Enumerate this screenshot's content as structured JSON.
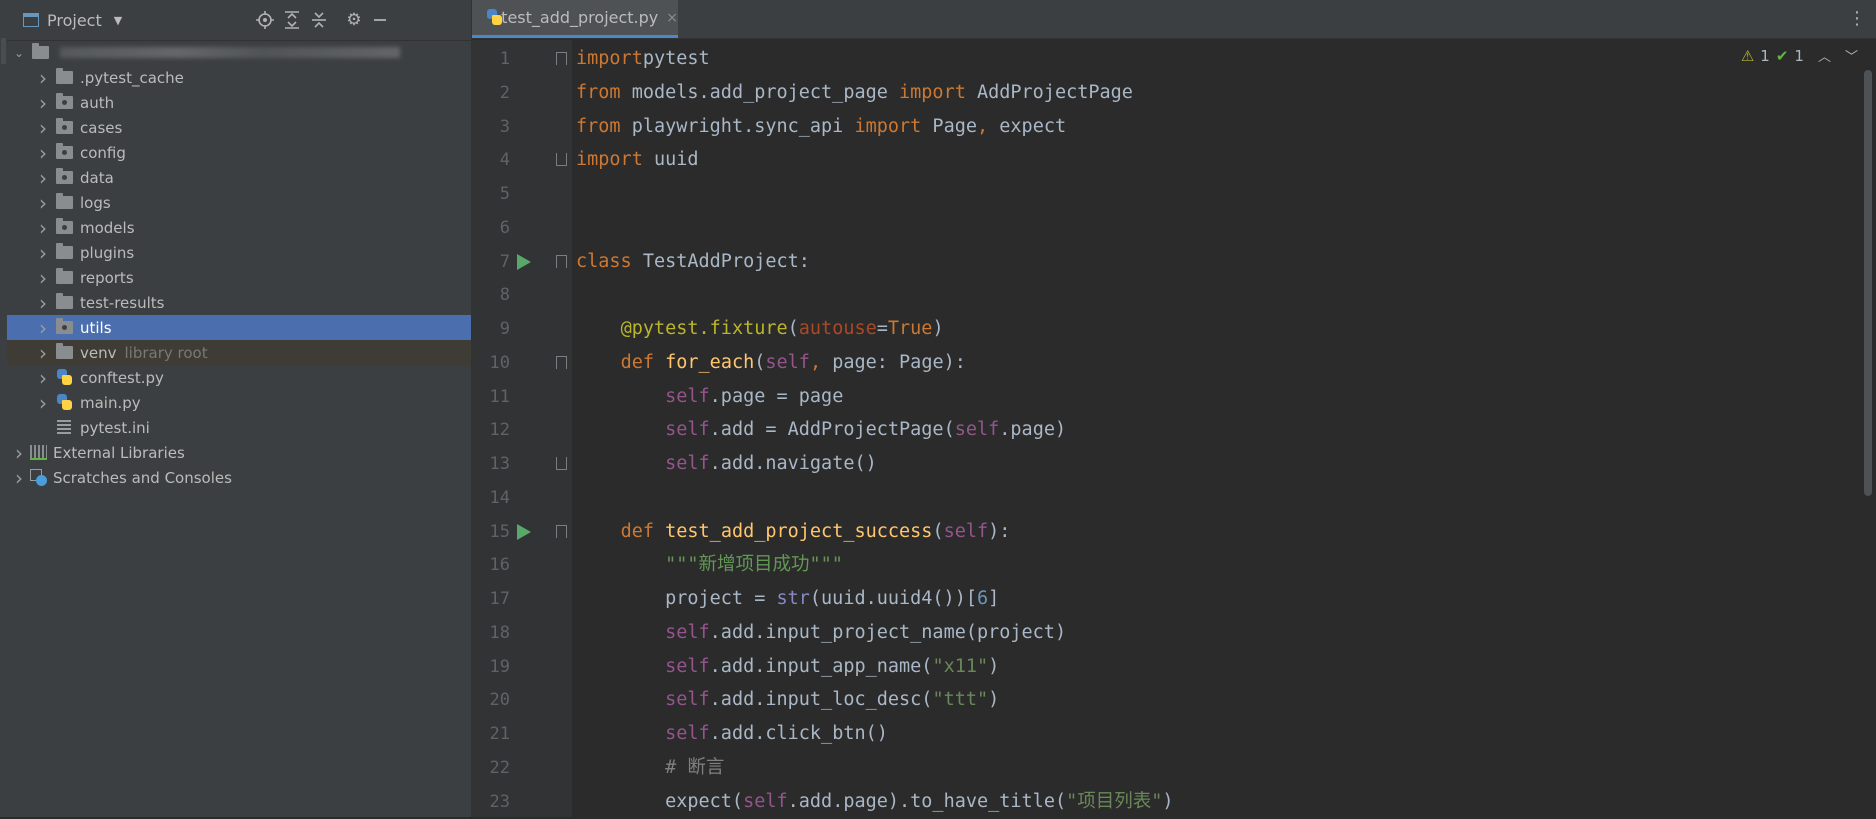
{
  "project_panel": {
    "title": "Project",
    "header_icons": [
      "locate-icon",
      "expand-all-icon",
      "collapse-all-icon",
      "gear-icon",
      "minimize-icon"
    ],
    "tree": [
      {
        "label": ".pytest_cache",
        "kind": "folder"
      },
      {
        "label": "auth",
        "kind": "package"
      },
      {
        "label": "cases",
        "kind": "package"
      },
      {
        "label": "config",
        "kind": "package"
      },
      {
        "label": "data",
        "kind": "package"
      },
      {
        "label": "logs",
        "kind": "folder"
      },
      {
        "label": "models",
        "kind": "package"
      },
      {
        "label": "plugins",
        "kind": "folder"
      },
      {
        "label": "reports",
        "kind": "folder"
      },
      {
        "label": "test-results",
        "kind": "folder"
      },
      {
        "label": "utils",
        "kind": "package",
        "selected": true
      },
      {
        "label": "venv",
        "kind": "folder",
        "hint": "library root"
      },
      {
        "label": "conftest.py",
        "kind": "python"
      },
      {
        "label": "main.py",
        "kind": "python"
      },
      {
        "label": "pytest.ini",
        "kind": "ini"
      },
      {
        "label": "External Libraries",
        "kind": "libraries"
      },
      {
        "label": "Scratches and Consoles",
        "kind": "scratches"
      }
    ]
  },
  "editor": {
    "tab": {
      "label": "test_add_project.py",
      "close": "×"
    },
    "menu": "⋮",
    "status": {
      "warnings": "1",
      "checks": "1"
    },
    "line_numbers": [
      "1",
      "2",
      "3",
      "4",
      "5",
      "6",
      "7",
      "8",
      "9",
      "10",
      "11",
      "12",
      "13",
      "14",
      "15",
      "16",
      "17",
      "18",
      "19",
      "20",
      "21",
      "22",
      "23"
    ],
    "lines": [
      [
        [
          "kw",
          "import"
        ],
        [
          "",
          "pytest"
        ]
      ],
      [
        [
          "kw",
          "from"
        ],
        [
          "",
          " models.add_project_page "
        ],
        [
          "kw",
          "import"
        ],
        [
          "",
          " AddProjectPage"
        ]
      ],
      [
        [
          "kw",
          "from"
        ],
        [
          "",
          " playwright.sync_api "
        ],
        [
          "kw",
          "import"
        ],
        [
          "",
          " Page"
        ],
        [
          "kw",
          ","
        ],
        [
          "",
          " expect"
        ]
      ],
      [
        [
          "kw",
          "import"
        ],
        [
          "",
          " uuid"
        ]
      ],
      [],
      [],
      [
        [
          "kw",
          "class"
        ],
        [
          "",
          " TestAddProject:"
        ]
      ],
      [],
      [
        [
          "",
          "    "
        ],
        [
          "dec",
          "@pytest.fixture"
        ],
        [
          "",
          "("
        ],
        [
          "param",
          "autouse"
        ],
        [
          "",
          "="
        ],
        [
          "kw",
          "True"
        ],
        [
          "",
          ")"
        ]
      ],
      [
        [
          "",
          "    "
        ],
        [
          "kw",
          "def"
        ],
        [
          "",
          " "
        ],
        [
          "fn",
          "for_each"
        ],
        [
          "",
          "("
        ],
        [
          "self",
          "self"
        ],
        [
          "kw",
          ","
        ],
        [
          "",
          " page: Page):"
        ]
      ],
      [
        [
          "",
          "        "
        ],
        [
          "self",
          "self"
        ],
        [
          "",
          ".page = page"
        ]
      ],
      [
        [
          "",
          "        "
        ],
        [
          "self",
          "self"
        ],
        [
          "",
          ".add = AddProjectPage("
        ],
        [
          "self",
          "self"
        ],
        [
          "",
          ".page)"
        ]
      ],
      [
        [
          "",
          "        "
        ],
        [
          "self",
          "self"
        ],
        [
          "",
          ".add.navigate()"
        ]
      ],
      [],
      [
        [
          "",
          "    "
        ],
        [
          "kw",
          "def"
        ],
        [
          "",
          " "
        ],
        [
          "fn",
          "test_add_project_success"
        ],
        [
          "",
          "("
        ],
        [
          "self",
          "self"
        ],
        [
          "",
          "):"
        ]
      ],
      [
        [
          "",
          "        "
        ],
        [
          "doc",
          "\"\"\"新增项目成功\"\"\""
        ]
      ],
      [
        [
          "",
          "        project = "
        ],
        [
          "bi",
          "str"
        ],
        [
          "",
          "(uuid.uuid4())["
        ],
        [
          "num",
          "6"
        ],
        [
          "",
          "]"
        ]
      ],
      [
        [
          "",
          "        "
        ],
        [
          "self",
          "self"
        ],
        [
          "",
          ".add.input_project_name(project)"
        ]
      ],
      [
        [
          "",
          "        "
        ],
        [
          "self",
          "self"
        ],
        [
          "",
          ".add.input_app_name("
        ],
        [
          "str",
          "\"x11\""
        ],
        [
          "",
          ")"
        ]
      ],
      [
        [
          "",
          "        "
        ],
        [
          "self",
          "self"
        ],
        [
          "",
          ".add.input_loc_desc("
        ],
        [
          "str",
          "\"ttt\""
        ],
        [
          "",
          ")"
        ]
      ],
      [
        [
          "",
          "        "
        ],
        [
          "self",
          "self"
        ],
        [
          "",
          ".add.click_btn()"
        ]
      ],
      [
        [
          "",
          "        "
        ],
        [
          "cmt",
          "# 断言"
        ]
      ],
      [
        [
          "",
          "        expect("
        ],
        [
          "self",
          "self"
        ],
        [
          "",
          ".add.page).to_have_title("
        ],
        [
          "str",
          "\"项目列表\""
        ],
        [
          "",
          ")"
        ]
      ]
    ]
  }
}
